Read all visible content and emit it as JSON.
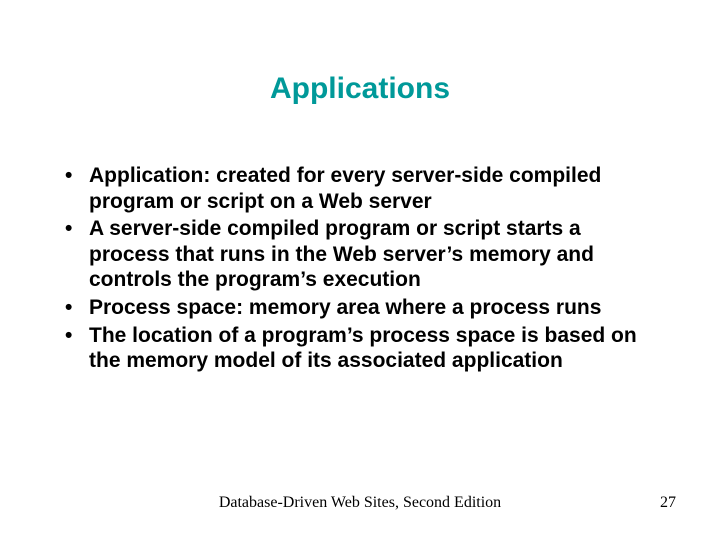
{
  "title": "Applications",
  "bullets": [
    "Application: created for every server-side compiled program or script on a Web server",
    "A server-side compiled program or script starts a process that runs in the Web server’s memory and controls the program’s execution",
    "Process space: memory area where a process runs",
    "The location of a program’s process space is based on the memory model of its associated application"
  ],
  "footer_center": "Database-Driven Web Sites, Second Edition",
  "page_number": "27"
}
